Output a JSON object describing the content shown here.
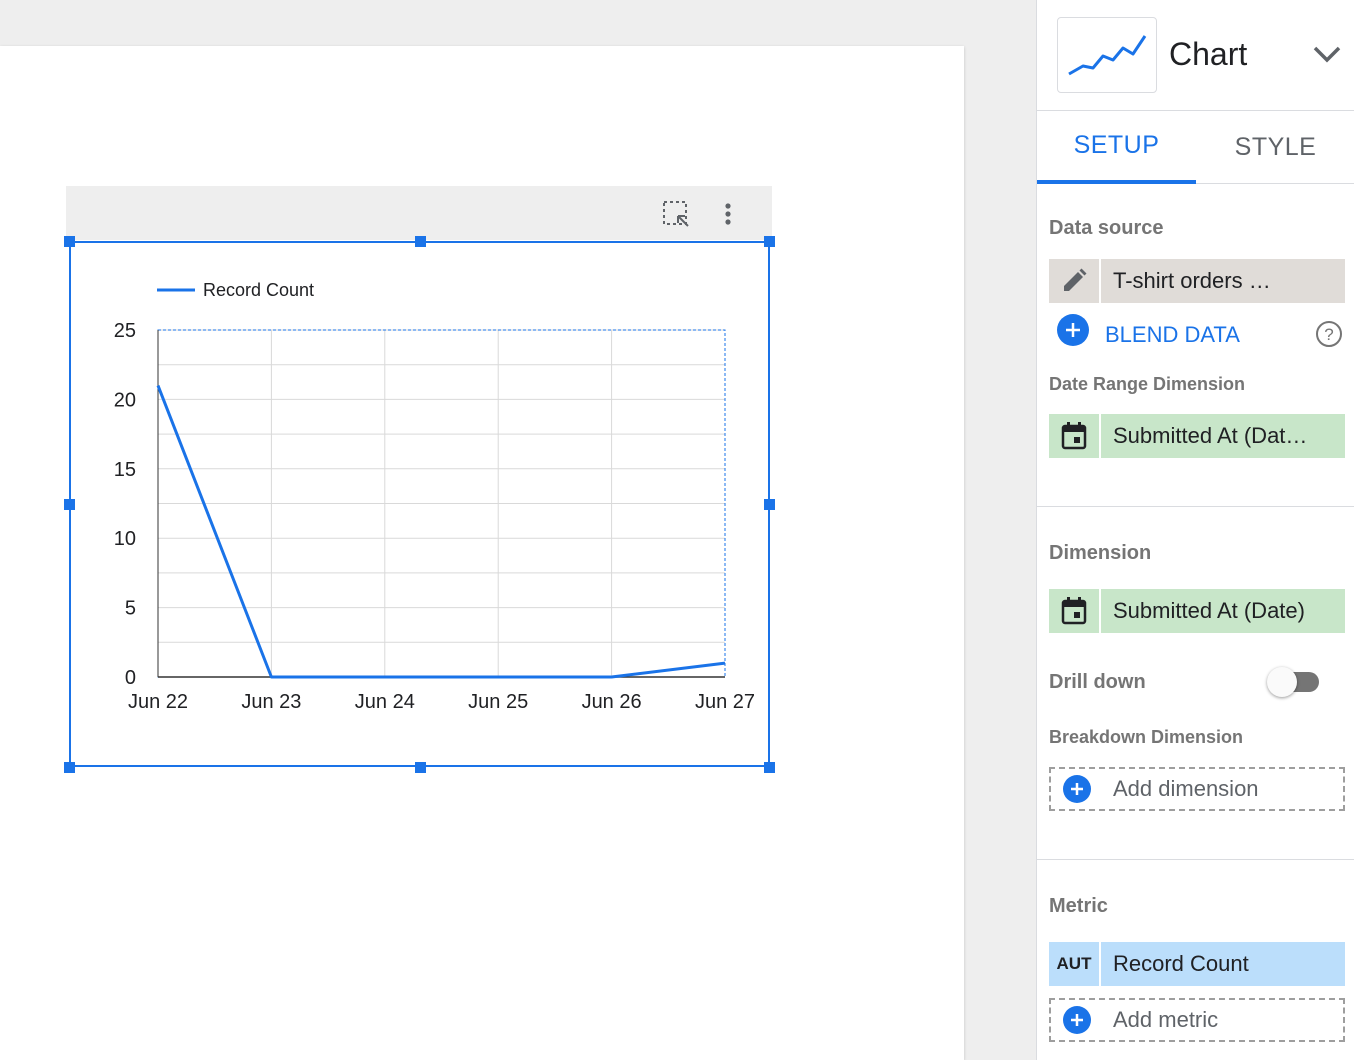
{
  "chart_data": {
    "type": "line",
    "title": "",
    "xlabel": "",
    "ylabel": "",
    "categories": [
      "Jun 22",
      "Jun 23",
      "Jun 24",
      "Jun 25",
      "Jun 26",
      "Jun 27"
    ],
    "series": [
      {
        "name": "Record Count",
        "values": [
          21,
          0,
          0,
          0,
          0,
          1
        ],
        "color": "#1a73e8"
      }
    ],
    "ylim": [
      0,
      25
    ],
    "yticks": [
      0,
      5,
      10,
      15,
      20,
      25
    ],
    "grid": true,
    "legend": "top-left"
  },
  "chart_header": {
    "select_icon": "select-area-icon",
    "more_icon": "more-vert-icon"
  },
  "panel": {
    "chart_type": {
      "title": "Chart",
      "icon": "line-chart-icon"
    },
    "tabs": [
      {
        "label": "SETUP",
        "active": true
      },
      {
        "label": "STYLE",
        "active": false
      }
    ],
    "data_source": {
      "label": "Data source",
      "value": "T-shirt orders …",
      "edit_icon": "pencil-icon",
      "blend_label": "BLEND DATA"
    },
    "date_range": {
      "label": "Date Range Dimension",
      "value": "Submitted At (Dat…",
      "icon": "calendar-icon"
    },
    "dimension": {
      "label": "Dimension",
      "value": "Submitted At (Date)",
      "icon": "calendar-icon"
    },
    "drill_down": {
      "label": "Drill down",
      "enabled": false
    },
    "breakdown": {
      "label": "Breakdown Dimension",
      "add_label": "Add dimension"
    },
    "metric": {
      "label": "Metric",
      "badge": "AUT",
      "value": "Record Count",
      "add_label": "Add metric"
    }
  },
  "colors": {
    "accent": "#1a73e8",
    "dimension_chip": "#c8e6c9",
    "metric_chip": "#bbdefb",
    "source_chip": "#e0dcd8"
  }
}
